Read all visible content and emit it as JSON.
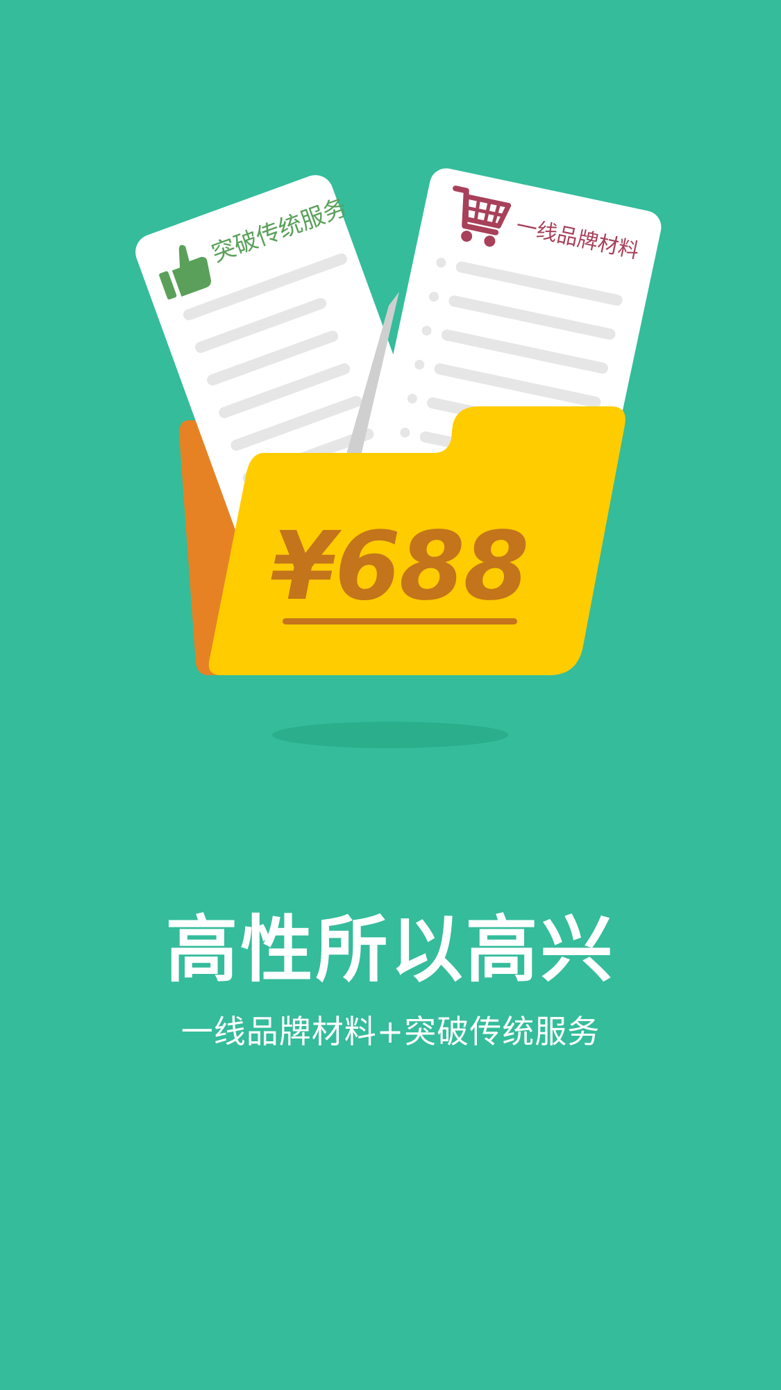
{
  "colors": {
    "background": "#34bc9b",
    "paper": "#ffffff",
    "paper_line": "#e6e6e6",
    "service_green": "#5aa05a",
    "cart_red": "#a8405a",
    "folder_front": "#ffcc00",
    "folder_back": "#e68224",
    "price_brown": "#c4741b",
    "shadow": "#2aae8c"
  },
  "left_card": {
    "icon": "thumbs-up-icon",
    "label": "突破传统服务"
  },
  "right_card": {
    "icon": "shopping-cart-icon",
    "label": "一线品牌材料"
  },
  "folder": {
    "price": "¥688"
  },
  "headline": "高性所以高兴",
  "subline": "一线品牌材料+突破传统服务"
}
